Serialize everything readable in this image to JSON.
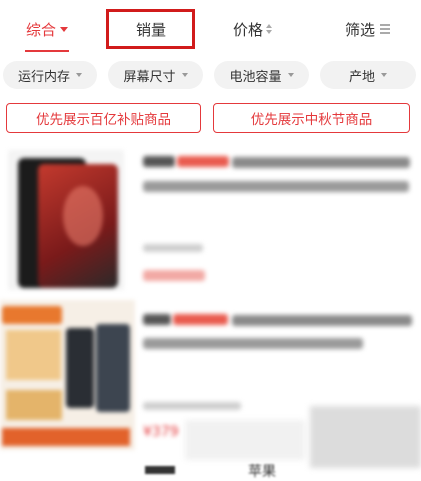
{
  "sort_bar": {
    "items": [
      {
        "label": "综合",
        "active": true
      },
      {
        "label": "销量",
        "active": false,
        "highlighted": true
      },
      {
        "label": "价格",
        "active": false
      },
      {
        "label": "筛选",
        "active": false
      }
    ]
  },
  "filter_chips": [
    "运行内存",
    "屏幕尺寸",
    "电池容量",
    "产地"
  ],
  "promo_buttons": [
    "优先展示百亿补贴商品",
    "优先展示中秋节商品"
  ],
  "products": [
    {
      "price_partial": "¥"
    },
    {
      "price_partial": "¥379"
    }
  ],
  "bottom_partial_text": "苹果",
  "colors": {
    "accent": "#e4393c",
    "highlight_box": "#d11b1b",
    "chip_bg": "#f2f2f2"
  }
}
